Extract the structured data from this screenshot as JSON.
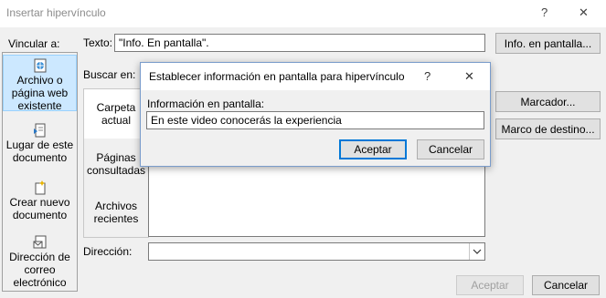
{
  "window": {
    "title": "Insertar hipervínculo",
    "help_glyph": "?",
    "close_glyph": "✕"
  },
  "link_to": {
    "label": "Vincular a:",
    "items": [
      {
        "label": "Archivo o página web existente",
        "icon": "web-page-icon"
      },
      {
        "label": "Lugar de este documento",
        "icon": "document-place-icon"
      },
      {
        "label": "Crear nuevo documento",
        "icon": "new-document-icon"
      },
      {
        "label": "Dirección de correo electrónico",
        "icon": "email-icon"
      }
    ]
  },
  "text_row": {
    "label": "Texto:",
    "value": "\"Info. En pantalla\".",
    "screentip_button": "Info. en pantalla..."
  },
  "look_in": {
    "label": "Buscar en:"
  },
  "tabs": [
    {
      "label": "Carpeta actual"
    },
    {
      "label": "Páginas consultadas"
    },
    {
      "label": "Archivos recientes"
    }
  ],
  "side_buttons": {
    "bookmark": "Marcador...",
    "target_frame": "Marco de destino..."
  },
  "address": {
    "label": "Dirección:",
    "value": ""
  },
  "footer": {
    "ok": "Aceptar",
    "cancel": "Cancelar"
  },
  "screentip_dialog": {
    "title": "Establecer información en pantalla para hipervínculo",
    "help_glyph": "?",
    "close_glyph": "✕",
    "field_label": "Información en pantalla:",
    "field_value": "En este video conocerás  la experiencia",
    "ok": "Aceptar",
    "cancel": "Cancelar"
  },
  "colors": {
    "selection": "#cce8ff",
    "accent": "#0078d7"
  }
}
